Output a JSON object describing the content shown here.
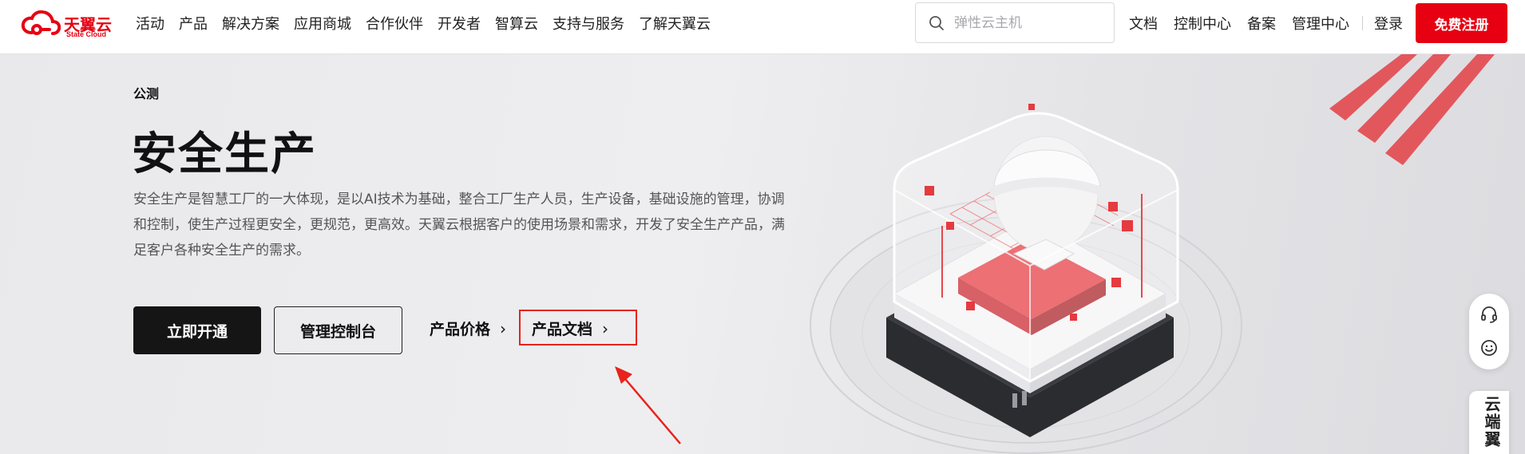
{
  "header": {
    "logo": {
      "cn": "天翼云",
      "en": "State Cloud",
      "icon": "cloud-logo-icon"
    },
    "nav": [
      "活动",
      "产品",
      "解决方案",
      "应用商城",
      "合作伙伴",
      "开发者",
      "智算云",
      "支持与服务",
      "了解天翼云"
    ],
    "search": {
      "placeholder": "弹性云主机",
      "icon": "search-icon"
    },
    "links": [
      "文档",
      "控制中心",
      "备案",
      "管理中心"
    ],
    "login": "登录",
    "register": "免费注册"
  },
  "hero": {
    "badge": "公测",
    "title": "安全生产",
    "description": "安全生产是智慧工厂的一大体现，是以AI技术为基础，整合工厂生产人员，生产设备，基础设施的管理，协调和控制，使生产过程更安全，更规范，更高效。天翼云根据客户的使用场景和需求，开发了安全生产产品，满足客户各种安全生产的需求。",
    "primary_button": "立即开通",
    "secondary_button": "管理控制台",
    "link_price": "产品价格",
    "link_docs": "产品文档"
  },
  "floating": {
    "tools": [
      "headset-icon",
      "smile-icon"
    ],
    "ai_tab": "云端翼"
  },
  "colors": {
    "brand": "#e60012",
    "primary_button": "#151515",
    "highlight": "#e8231c"
  }
}
